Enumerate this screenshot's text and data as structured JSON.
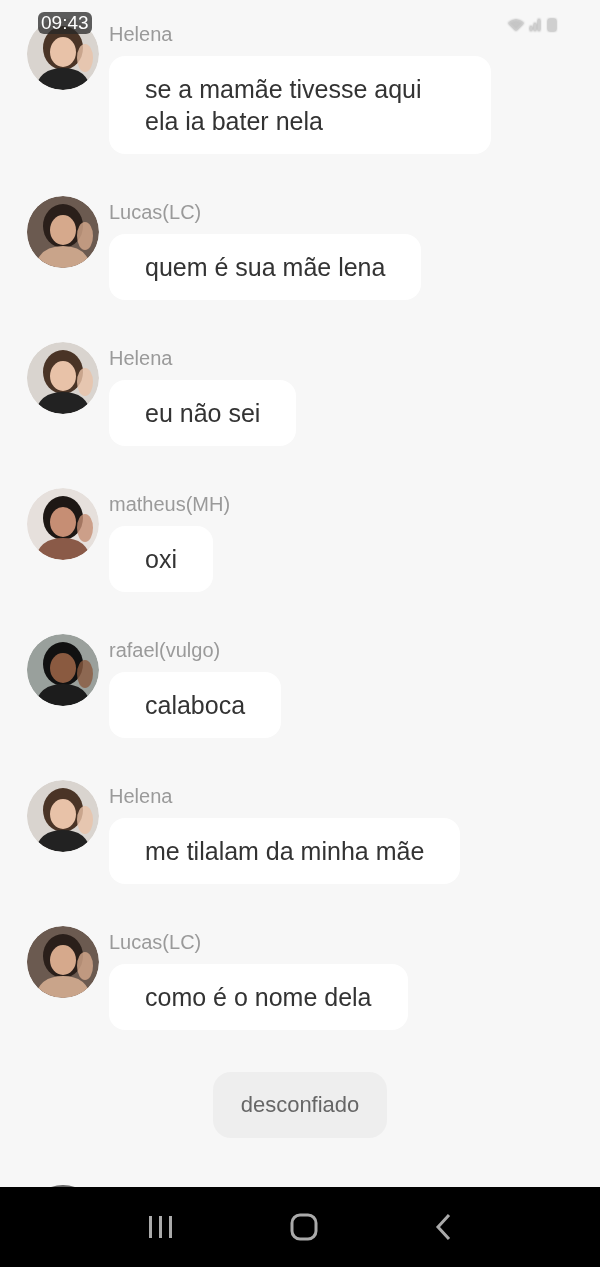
{
  "status_bar": {
    "time": "09:43"
  },
  "messages": [
    {
      "sender": "Helena",
      "text": "se a mamãe tivesse aqui ela ia bater nela"
    },
    {
      "sender": "Lucas(LC)",
      "text": "quem é sua mãe lena"
    },
    {
      "sender": "Helena",
      "text": "eu não sei"
    },
    {
      "sender": "matheus(MH)",
      "text": "oxi"
    },
    {
      "sender": "rafael(vulgo)",
      "text": "calaboca"
    },
    {
      "sender": "Helena",
      "text": "me tilalam da minha mãe"
    },
    {
      "sender": "Lucas(LC)",
      "text": "como é o nome dela"
    }
  ],
  "system_notice": "desconfiado"
}
